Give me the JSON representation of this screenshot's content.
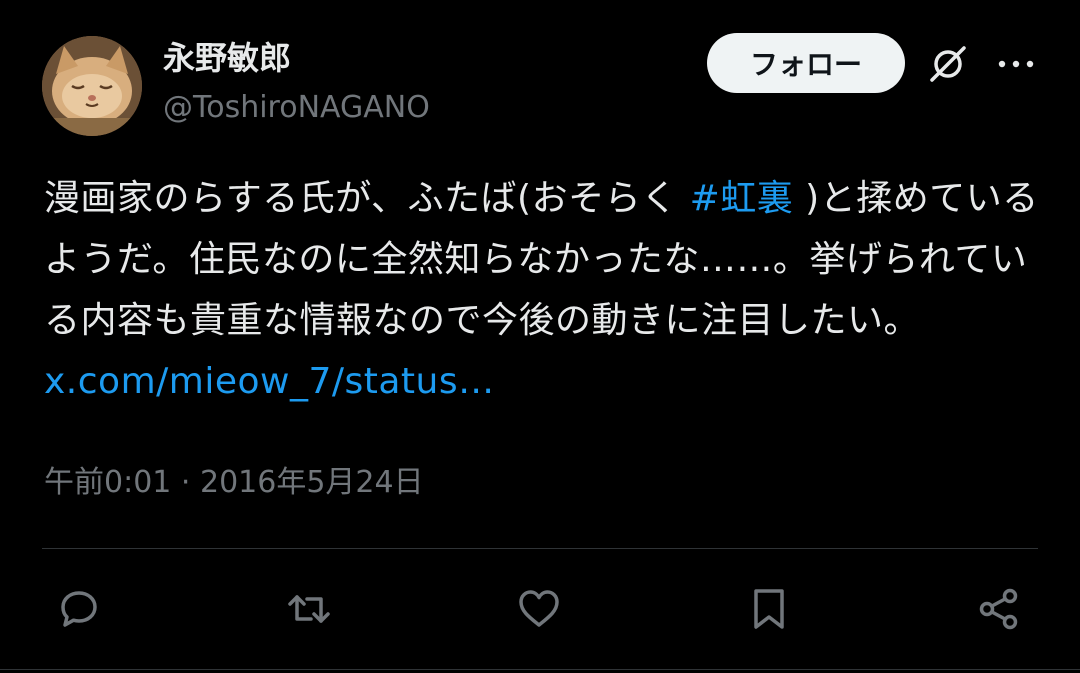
{
  "user": {
    "display_name": "永野敏郎",
    "handle": "@ToshiroNAGANO"
  },
  "follow_button": {
    "label": "フォロー"
  },
  "tweet": {
    "text_part1": "漫画家のらする氏が、ふたば(おそらく ",
    "hashtag": "#虹裏",
    "text_part2": " )と揉めているようだ。住民なのに全然知らなかったな……。挙げられている内容も貴重な情報なので今後の動きに注目したい。 ",
    "link": "x.com/mieow_7/status…"
  },
  "timestamp": "午前0:01 · 2016年5月24日",
  "colors": {
    "background": "#000000",
    "text": "#e7e9ea",
    "secondary": "#71767b",
    "accent": "#1d9bf0",
    "divider": "#2f3336"
  },
  "icons": {
    "grok": "grok-icon",
    "more": "more-icon",
    "reply": "reply-icon",
    "retweet": "retweet-icon",
    "like": "like-icon",
    "bookmark": "bookmark-icon",
    "share": "share-icon"
  }
}
